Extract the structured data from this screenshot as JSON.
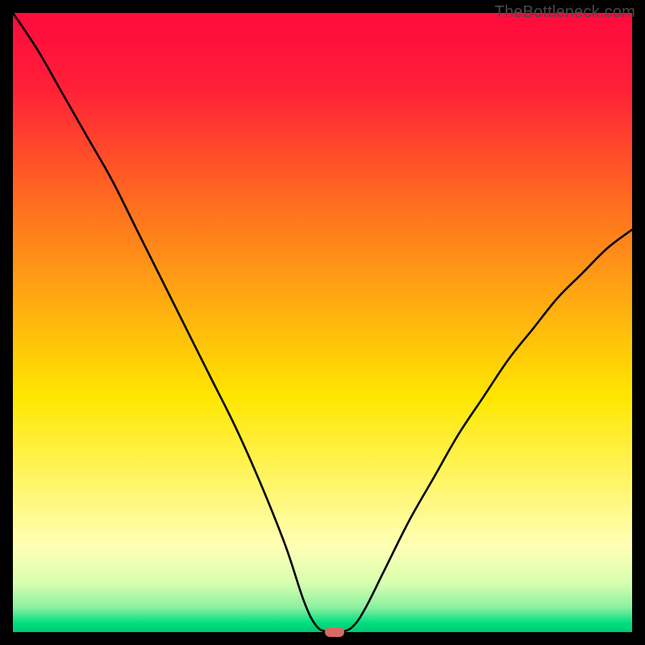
{
  "attribution": "TheBottleneck.com",
  "chart_data": {
    "type": "line",
    "title": "",
    "xlabel": "",
    "ylabel": "",
    "xlim": [
      0,
      100
    ],
    "ylim": [
      0,
      100
    ],
    "grid": false,
    "legend": false,
    "background_gradient": {
      "stops": [
        {
          "offset": 0.0,
          "color": "#ff0a3c"
        },
        {
          "offset": 0.12,
          "color": "#ff1f38"
        },
        {
          "offset": 0.3,
          "color": "#ff6a20"
        },
        {
          "offset": 0.48,
          "color": "#ffb010"
        },
        {
          "offset": 0.62,
          "color": "#ffe600"
        },
        {
          "offset": 0.76,
          "color": "#fff66a"
        },
        {
          "offset": 0.86,
          "color": "#ffffb5"
        },
        {
          "offset": 0.92,
          "color": "#d8ffb0"
        },
        {
          "offset": 0.96,
          "color": "#8cf0a0"
        },
        {
          "offset": 0.985,
          "color": "#00e080"
        },
        {
          "offset": 1.0,
          "color": "#00c870"
        }
      ]
    },
    "series": [
      {
        "name": "bottleneck-curve",
        "color": "#000000",
        "x": [
          0,
          4,
          8,
          12,
          16,
          20,
          24,
          28,
          32,
          36,
          40,
          44,
          47,
          49,
          51,
          53,
          55,
          57,
          60,
          64,
          68,
          72,
          76,
          80,
          84,
          88,
          92,
          96,
          100
        ],
        "y": [
          100,
          94,
          87,
          80,
          73,
          65,
          57,
          49,
          41,
          33,
          24,
          14,
          5,
          1,
          0,
          0,
          1,
          4,
          10,
          18,
          25,
          32,
          38,
          44,
          49,
          54,
          58,
          62,
          65
        ]
      }
    ],
    "markers": [
      {
        "name": "optimal-point",
        "x": 52,
        "y": 0,
        "color": "#d86a62"
      }
    ]
  }
}
